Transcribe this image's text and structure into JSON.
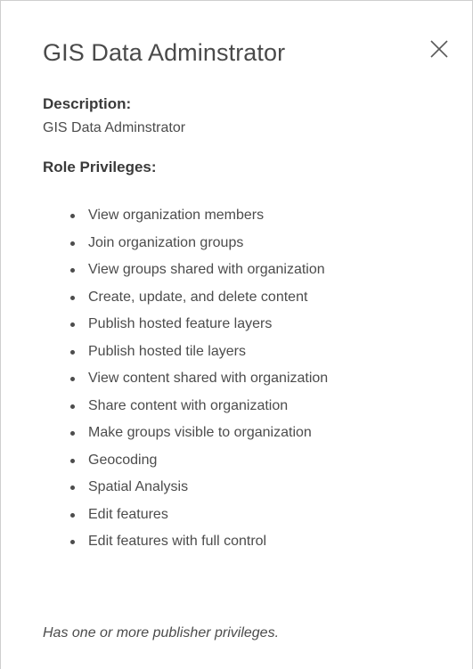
{
  "dialog": {
    "title": "GIS Data Adminstrator",
    "close_icon": "close-icon",
    "description_label": "Description:",
    "description_value": "GIS Data Adminstrator",
    "privileges_label": "Role Privileges:",
    "privileges": [
      "View organization members",
      "Join organization groups",
      "View groups shared with organization",
      "Create, update, and delete content",
      "Publish hosted feature layers",
      "Publish hosted tile layers",
      "View content shared with organization",
      "Share content with organization",
      "Make groups visible to organization",
      "Geocoding",
      "Spatial Analysis",
      "Edit features",
      "Edit features with full control"
    ],
    "note": "Has one or more publisher privileges."
  },
  "colors": {
    "text": "#4c4c4c",
    "border": "#cfcfcf",
    "background": "#ffffff"
  }
}
